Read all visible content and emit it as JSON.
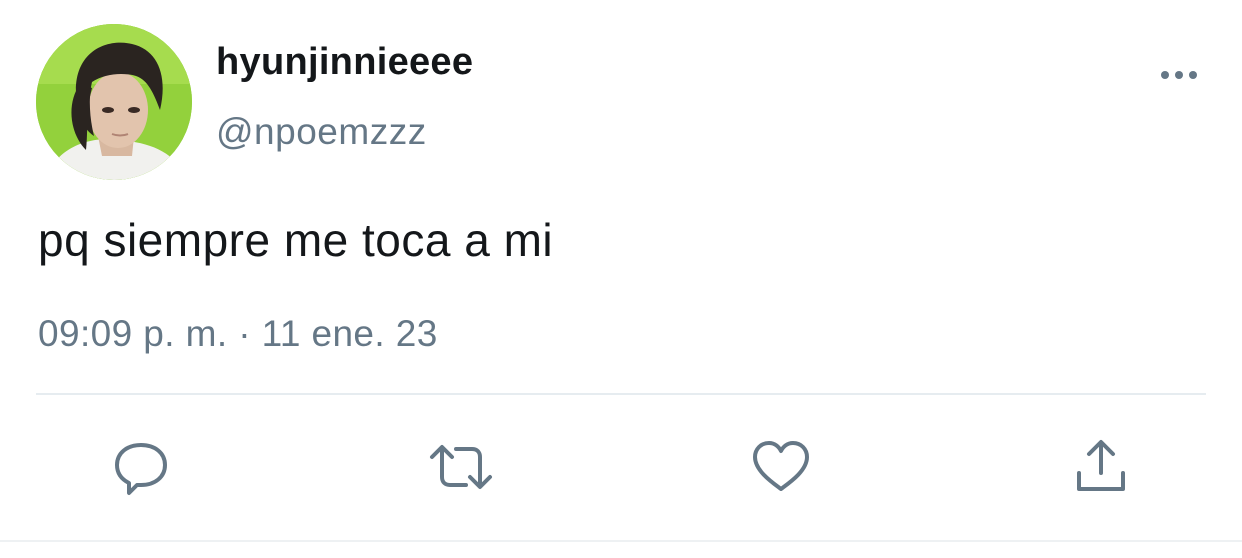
{
  "tweet": {
    "author": {
      "display_name": "hyunjinnieeee",
      "handle": "@npoemzzz",
      "avatar_icon": "profile-photo"
    },
    "text": "pq siempre me toca a mi",
    "timestamp": "09:09 p. m. · 11 ene. 23"
  },
  "actions": {
    "reply_icon": "reply-icon",
    "retweet_icon": "retweet-icon",
    "like_icon": "heart-icon",
    "share_icon": "share-icon",
    "more_icon": "more-options-icon"
  },
  "colors": {
    "text_primary": "#14171a",
    "text_secondary": "#657786",
    "icon": "#657786",
    "divider": "#e6ecf0",
    "avatar_background": "#8fce3a"
  }
}
